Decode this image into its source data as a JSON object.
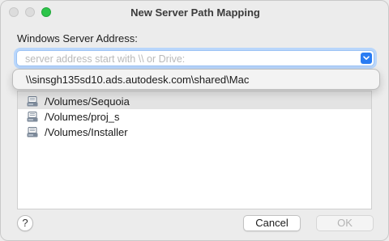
{
  "window": {
    "title": "New Server Path Mapping"
  },
  "form": {
    "address_label": "Windows Server Address:",
    "address_value": "",
    "address_placeholder": "server address start with \\\\ or Drive:"
  },
  "suggestion": {
    "text": "\\\\sinsgh135sd10.ads.autodesk.com\\shared\\Mac"
  },
  "volumes": [
    {
      "path": "/Volumes/Sequoia",
      "selected": true
    },
    {
      "path": "/Volumes/proj_s",
      "selected": false
    },
    {
      "path": "/Volumes/Installer",
      "selected": false
    }
  ],
  "footer": {
    "help_label": "?",
    "cancel_label": "Cancel",
    "ok_label": "OK"
  },
  "colors": {
    "accent": "#2a7cf2",
    "zoom_button": "#2dc54a",
    "selection": "#e3e3e3"
  }
}
